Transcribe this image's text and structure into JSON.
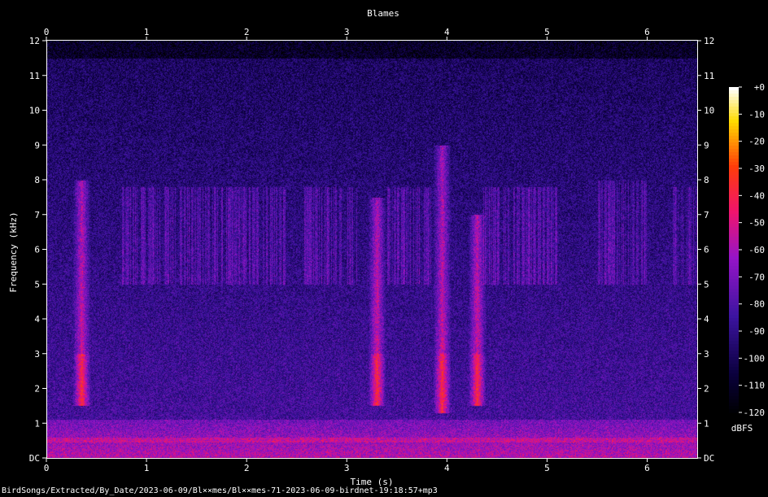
{
  "chart_data": {
    "type": "heatmap",
    "title": "Blames",
    "xlabel": "Time (s)",
    "ylabel": "Frequency (kHz)",
    "xlim": [
      0,
      6.5
    ],
    "ylim": [
      0,
      12
    ],
    "x_ticks": [
      "0",
      "1",
      "2",
      "3",
      "4",
      "5",
      "6"
    ],
    "y_ticks": [
      "DC",
      "1",
      "2",
      "3",
      "4",
      "5",
      "6",
      "7",
      "8",
      "9",
      "10",
      "11",
      "12"
    ],
    "colorbar": {
      "label": "dBFS",
      "range": [
        -120,
        0
      ],
      "ticks": [
        "+0",
        "-10",
        "-20",
        "-30",
        "-40",
        "-50",
        "-60",
        "-70",
        "-80",
        "-90",
        "-100",
        "-110",
        "-120"
      ]
    },
    "colors": {
      "low": "#000000",
      "mid": "#5a1fb0",
      "high": "#ff1060",
      "peak": "#ffffff"
    },
    "calls": [
      {
        "type": "sweep",
        "t": 0.35,
        "f_low": 1.5,
        "f_high": 8.0
      },
      {
        "type": "sweep",
        "t": 3.3,
        "f_low": 1.5,
        "f_high": 7.5
      },
      {
        "type": "sweep",
        "t": 3.95,
        "f_low": 1.3,
        "f_high": 9.0
      },
      {
        "type": "sweep",
        "t": 4.3,
        "f_low": 1.5,
        "f_high": 7.0
      },
      {
        "type": "band",
        "t_start": 0.75,
        "t_end": 2.4,
        "f_low": 5.0,
        "f_high": 7.8
      },
      {
        "type": "band",
        "t_start": 2.55,
        "t_end": 3.1,
        "f_low": 5.0,
        "f_high": 7.8
      },
      {
        "type": "band",
        "t_start": 3.4,
        "t_end": 3.85,
        "f_low": 5.0,
        "f_high": 7.8
      },
      {
        "type": "band",
        "t_start": 4.35,
        "t_end": 5.1,
        "f_low": 5.0,
        "f_high": 7.8
      },
      {
        "type": "band",
        "t_start": 5.5,
        "t_end": 6.0,
        "f_low": 5.0,
        "f_high": 8.0
      },
      {
        "type": "band",
        "t_start": 6.25,
        "t_end": 6.5,
        "f_low": 5.0,
        "f_high": 7.8
      }
    ]
  },
  "footer": "BirdSongs/Extracted/By_Date/2023-06-09/Bl××mes/Bl××mes-71-2023-06-09-birdnet-19:18:57+mp3"
}
